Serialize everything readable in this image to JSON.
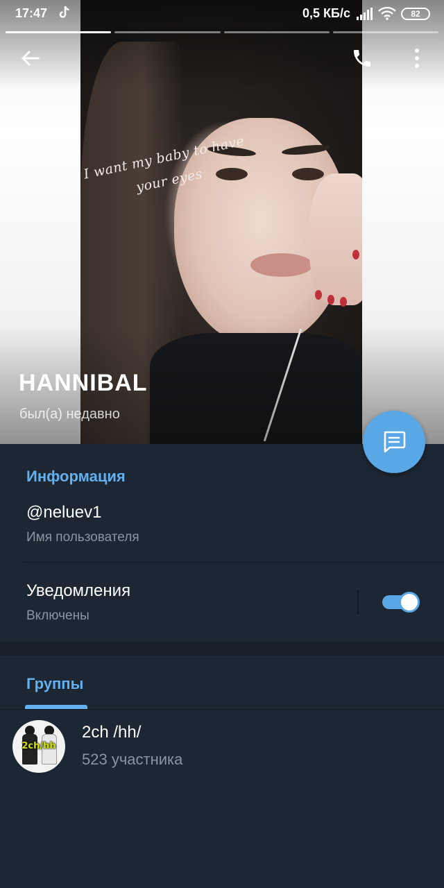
{
  "status_bar": {
    "time": "17:47",
    "net_speed": "0,5 КБ/с",
    "battery": "82",
    "icons": [
      "tiktok-icon",
      "signal-icon",
      "wifi-icon",
      "battery-icon"
    ]
  },
  "story": {
    "segments": 4,
    "active_index": 0,
    "caption_line1": "I want my baby to have",
    "caption_line2": "your eyes"
  },
  "header": {
    "name": "HANNIBAL",
    "last_seen": "был(а) недавно",
    "actions": [
      "back-icon",
      "phone-icon",
      "more-vert-icon"
    ]
  },
  "fab": {
    "icon": "message-icon",
    "color": "#5aa7e6"
  },
  "info": {
    "title": "Информация",
    "username": "@neluev1",
    "username_label": "Имя пользователя",
    "notifications_label": "Уведомления",
    "notifications_state": "Включены",
    "notifications_on": true
  },
  "groups": {
    "tab_label": "Группы",
    "items": [
      {
        "name": "2ch /hh/",
        "members": "523 участника",
        "avatar_text": "2ch/hh"
      }
    ]
  },
  "colors": {
    "background": "#1d2733",
    "accent": "#62b0f0",
    "secondary_text": "#8a959f",
    "toggle": "#5aa7e6"
  }
}
